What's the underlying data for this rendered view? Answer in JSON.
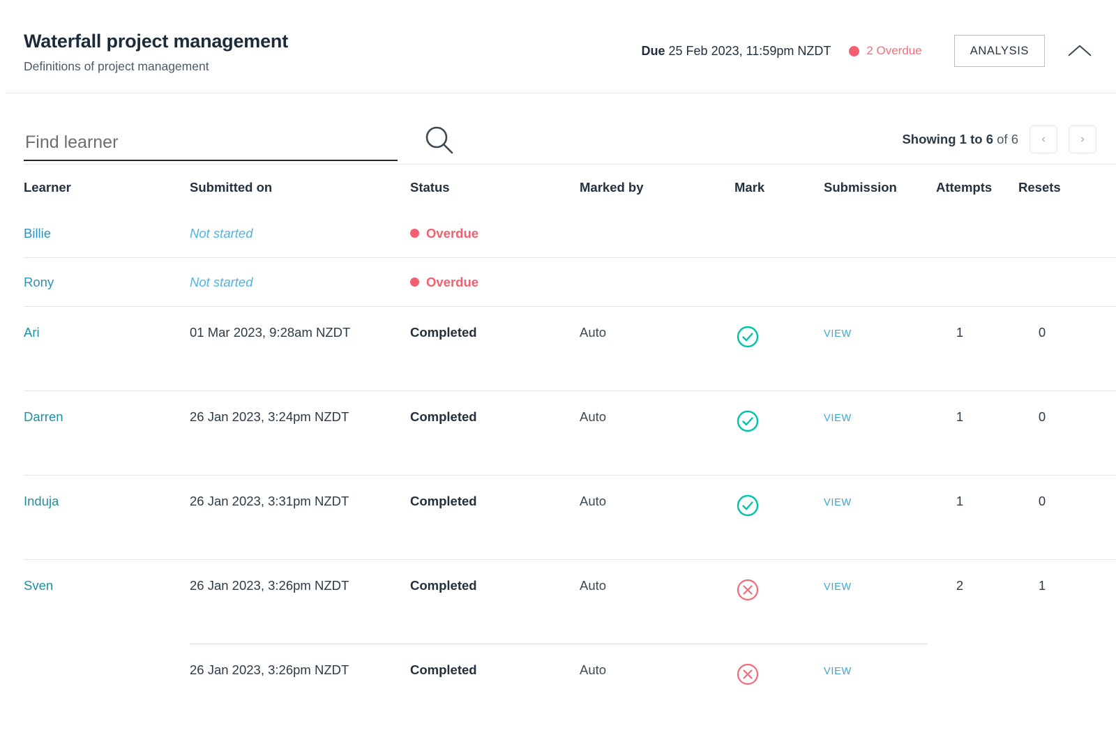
{
  "header": {
    "title": "Waterfall project management",
    "subtitle": "Definitions of project management",
    "due_label": "Due",
    "due_value": "25 Feb 2023, 11:59pm NZDT",
    "overdue_count_label": "2 Overdue",
    "analysis_button": "ANALYSIS",
    "collapse_icon": "chevron-up-icon"
  },
  "toolbar": {
    "search_placeholder": "Find learner",
    "search_value": "",
    "search_icon": "search-icon",
    "showing_prefix": "Showing",
    "showing_range": "1 to 6",
    "showing_of": "of 6",
    "prev_label": "‹",
    "next_label": "›"
  },
  "table": {
    "columns": [
      "Learner",
      "Submitted on",
      "Status",
      "Marked by",
      "Mark",
      "Submission",
      "Attempts",
      "Resets"
    ],
    "rows": [
      {
        "learner": "Billie",
        "submitted_on": "Not started",
        "submitted_state": "not-started",
        "status": "Overdue",
        "status_state": "overdue",
        "marked_by": "",
        "mark": "",
        "submission": "",
        "attempts": "",
        "resets": ""
      },
      {
        "learner": "Rony",
        "submitted_on": "Not started",
        "submitted_state": "not-started",
        "status": "Overdue",
        "status_state": "overdue",
        "marked_by": "",
        "mark": "",
        "submission": "",
        "attempts": "",
        "resets": ""
      },
      {
        "learner": "Ari",
        "submitted_on": "01 Mar 2023, 9:28am NZDT",
        "submitted_state": "date",
        "status": "Completed",
        "status_state": "completed",
        "marked_by": "Auto",
        "mark": "pass-check-icon",
        "submission": "VIEW",
        "attempts": "1",
        "resets": "0"
      },
      {
        "learner": "Darren",
        "submitted_on": "26 Jan 2023, 3:24pm NZDT",
        "submitted_state": "date",
        "status": "Completed",
        "status_state": "completed",
        "marked_by": "Auto",
        "mark": "pass-check-icon",
        "submission": "VIEW",
        "attempts": "1",
        "resets": "0"
      },
      {
        "learner": "Induja",
        "submitted_on": "26 Jan 2023, 3:31pm NZDT",
        "submitted_state": "date",
        "status": "Completed",
        "status_state": "completed",
        "marked_by": "Auto",
        "mark": "pass-check-icon",
        "submission": "VIEW",
        "attempts": "1",
        "resets": "0"
      },
      {
        "learner": "Sven",
        "submitted_on": "26 Jan 2023, 3:26pm NZDT",
        "submitted_state": "date",
        "status": "Completed",
        "status_state": "completed",
        "marked_by": "Auto",
        "mark": "fail-cross-icon",
        "submission": "VIEW",
        "attempts": "2",
        "resets": "1"
      },
      {
        "learner": "",
        "submitted_on": "26 Jan 2023, 3:26pm NZDT",
        "submitted_state": "date",
        "status": "Completed",
        "status_state": "completed",
        "marked_by": "Auto",
        "mark": "fail-cross-icon",
        "submission": "VIEW",
        "attempts": "",
        "resets": "",
        "indented": true
      }
    ]
  },
  "colors": {
    "overdue": "#f2606f",
    "pass": "#00c4a7",
    "fail": "#f26b7a",
    "link": "#2f93b8",
    "view_link": "#3fa5cf",
    "not_started": "#4fb5e2",
    "text": "#2c3a48",
    "rule": "#e3e5e8"
  }
}
